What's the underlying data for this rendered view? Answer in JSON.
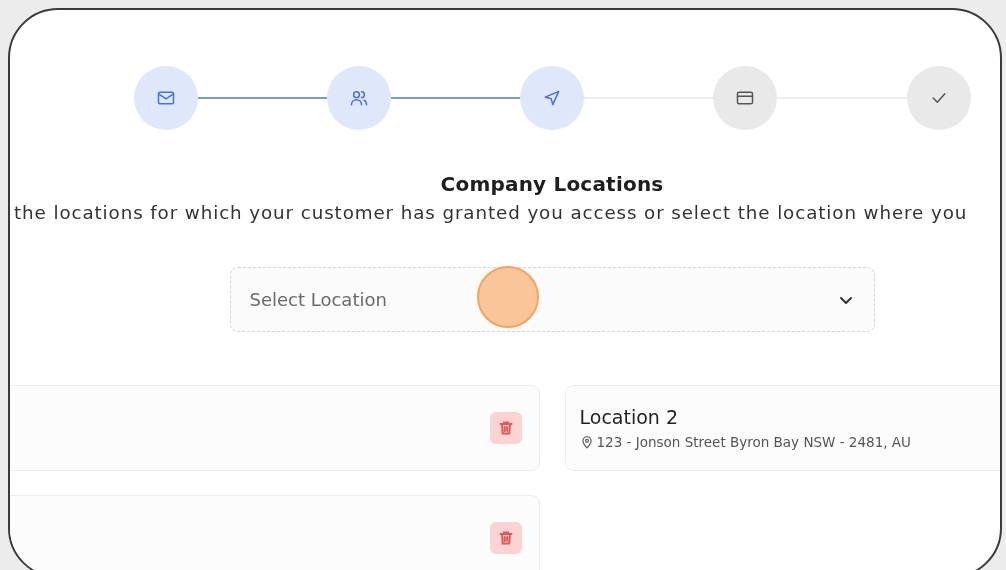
{
  "steps": [
    {
      "kind": "mail",
      "reached": true
    },
    {
      "kind": "users",
      "reached": true
    },
    {
      "kind": "send",
      "reached": true
    },
    {
      "kind": "card",
      "reached": false
    },
    {
      "kind": "check",
      "reached": false
    }
  ],
  "title": "Company Locations",
  "subtitle": "the locations for which your customer has granted you access or select the location where you",
  "location_select": {
    "placeholder": "Select Location"
  },
  "locations": [
    {
      "kind": "removable"
    },
    {
      "kind": "entry",
      "name": "Location 2",
      "address": "123 - Jonson Street Byron Bay NSW - 2481, AU"
    },
    {
      "kind": "removable"
    }
  ]
}
